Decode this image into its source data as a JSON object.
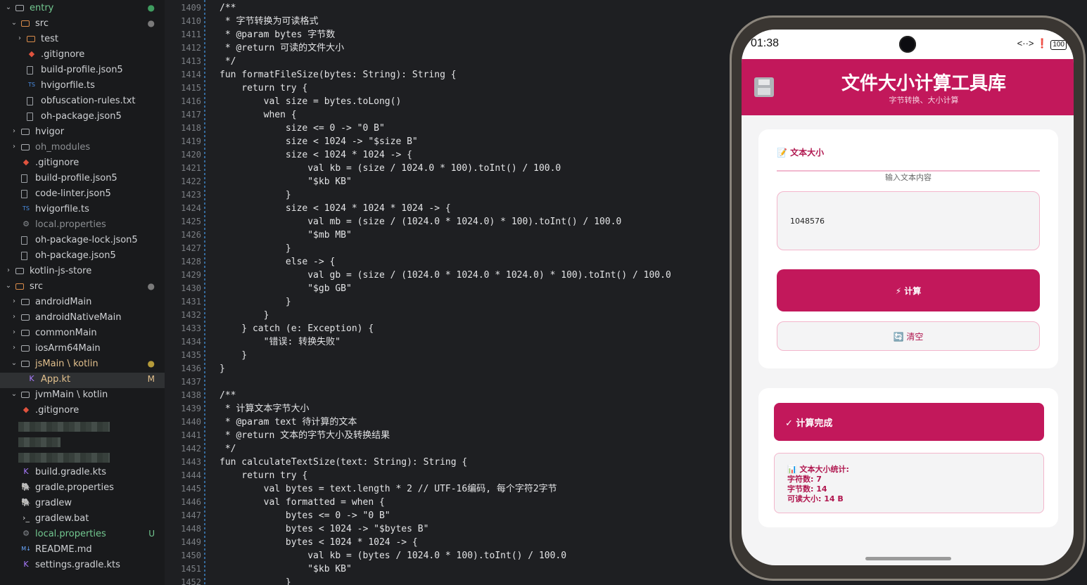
{
  "explorer": {
    "items": [
      {
        "label": "entry",
        "type": "folder",
        "expanded": true,
        "depth": 0,
        "badge": "●",
        "badge_color": "#3f9c5f",
        "label_color": "#73c991"
      },
      {
        "label": "src",
        "type": "folder-src",
        "expanded": true,
        "depth": 1,
        "badge": "●",
        "badge_color": "#7a7a7a"
      },
      {
        "label": "test",
        "type": "folder-src",
        "expanded": false,
        "depth": 2,
        "badge": ""
      },
      {
        "label": ".gitignore",
        "type": "git",
        "depth": 2,
        "badge": ""
      },
      {
        "label": "build-profile.json5",
        "type": "file",
        "depth": 2,
        "badge": ""
      },
      {
        "label": "hvigorfile.ts",
        "type": "ts",
        "depth": 2,
        "badge": ""
      },
      {
        "label": "obfuscation-rules.txt",
        "type": "file",
        "depth": 2,
        "badge": ""
      },
      {
        "label": "oh-package.json5",
        "type": "file",
        "depth": 2,
        "badge": ""
      },
      {
        "label": "hvigor",
        "type": "folder",
        "expanded": false,
        "depth": 1,
        "badge": ""
      },
      {
        "label": "oh_modules",
        "type": "folder",
        "expanded": false,
        "depth": 1,
        "badge": "",
        "label_color": "#8c8f93"
      },
      {
        "label": ".gitignore",
        "type": "git",
        "depth": 1,
        "badge": ""
      },
      {
        "label": "build-profile.json5",
        "type": "file",
        "depth": 1,
        "badge": ""
      },
      {
        "label": "code-linter.json5",
        "type": "file",
        "depth": 1,
        "badge": ""
      },
      {
        "label": "hvigorfile.ts",
        "type": "ts",
        "depth": 1,
        "badge": ""
      },
      {
        "label": "local.properties",
        "type": "gear",
        "depth": 1,
        "badge": "",
        "label_color": "#8c8f93"
      },
      {
        "label": "oh-package-lock.json5",
        "type": "file",
        "depth": 1,
        "badge": ""
      },
      {
        "label": "oh-package.json5",
        "type": "file",
        "depth": 1,
        "badge": ""
      },
      {
        "label": "kotlin-js-store",
        "type": "folder",
        "expanded": false,
        "depth": 0,
        "badge": ""
      },
      {
        "label": "src",
        "type": "folder-src",
        "expanded": true,
        "depth": 0,
        "badge": "●",
        "badge_color": "#7a7a7a"
      },
      {
        "label": "androidMain",
        "type": "folder",
        "expanded": false,
        "depth": 1,
        "badge": ""
      },
      {
        "label": "androidNativeMain",
        "type": "folder",
        "expanded": false,
        "depth": 1,
        "badge": ""
      },
      {
        "label": "commonMain",
        "type": "folder",
        "expanded": false,
        "depth": 1,
        "badge": ""
      },
      {
        "label": "iosArm64Main",
        "type": "folder",
        "expanded": false,
        "depth": 1,
        "badge": ""
      },
      {
        "label": "jsMain \\ kotlin",
        "type": "folder",
        "expanded": true,
        "depth": 1,
        "badge": "●",
        "badge_color": "#b59b3a",
        "label_color": "#e2c08d"
      },
      {
        "label": "App.kt",
        "type": "kotlin",
        "depth": 2,
        "badge": "M",
        "badge_color": "#e2c08d",
        "label_color": "#e2c08d",
        "active": true
      },
      {
        "label": "jvmMain \\ kotlin",
        "type": "folder",
        "expanded": true,
        "depth": 1,
        "badge": ""
      },
      {
        "label": ".gitignore",
        "type": "git",
        "depth": 1,
        "badge": ""
      },
      {
        "label": "",
        "type": "blur",
        "depth": 1,
        "badge": ""
      },
      {
        "label": "",
        "type": "blur",
        "depth": 1,
        "badge": ""
      },
      {
        "label": "",
        "type": "blur",
        "depth": 1,
        "badge": ""
      },
      {
        "label": "build.gradle.kts",
        "type": "kotlin",
        "depth": 1,
        "badge": ""
      },
      {
        "label": "gradle.properties",
        "type": "gradle",
        "depth": 1,
        "badge": ""
      },
      {
        "label": "gradlew",
        "type": "gradle",
        "depth": 1,
        "badge": ""
      },
      {
        "label": "gradlew.bat",
        "type": "terminal",
        "depth": 1,
        "badge": ""
      },
      {
        "label": "local.properties",
        "type": "gear",
        "depth": 1,
        "badge": "U",
        "badge_color": "#73c991",
        "label_color": "#73c991"
      },
      {
        "label": "README.md",
        "type": "md",
        "depth": 1,
        "badge": ""
      },
      {
        "label": "settings.gradle.kts",
        "type": "kotlin",
        "depth": 1,
        "badge": ""
      }
    ]
  },
  "editor": {
    "first_line": 1409,
    "lines": [
      "/**",
      " * 字节转换为可读格式",
      " * @param bytes 字节数",
      " * @return 可读的文件大小",
      " */",
      "fun formatFileSize(bytes: String): String {",
      "    return try {",
      "        val size = bytes.toLong()",
      "        when {",
      "            size <= 0 -> \"0 B\"",
      "            size < 1024 -> \"$size B\"",
      "            size < 1024 * 1024 -> {",
      "                val kb = (size / 1024.0 * 100).toInt() / 100.0",
      "                \"$kb KB\"",
      "            }",
      "            size < 1024 * 1024 * 1024 -> {",
      "                val mb = (size / (1024.0 * 1024.0) * 100).toInt() / 100.0",
      "                \"$mb MB\"",
      "            }",
      "            else -> {",
      "                val gb = (size / (1024.0 * 1024.0 * 1024.0) * 100).toInt() / 100.0",
      "                \"$gb GB\"",
      "            }",
      "        }",
      "    } catch (e: Exception) {",
      "        \"错误: 转换失败\"",
      "    }",
      "}",
      "",
      "/**",
      " * 计算文本字节大小",
      " * @param text 待计算的文本",
      " * @return 文本的字节大小及转换结果",
      " */",
      "fun calculateTextSize(text: String): String {",
      "    return try {",
      "        val bytes = text.length * 2 // UTF-16编码, 每个字符2字节",
      "        val formatted = when {",
      "            bytes <= 0 -> \"0 B\"",
      "            bytes < 1024 -> \"$bytes B\"",
      "            bytes < 1024 * 1024 -> {",
      "                val kb = (bytes / 1024.0 * 100).toInt() / 100.0",
      "                \"$kb KB\"",
      "            }"
    ]
  },
  "phone": {
    "status": {
      "time": "01:38",
      "icons": "<··> ❗",
      "battery": "100"
    },
    "header": {
      "title": "文件大小计算工具库",
      "subtitle": "字节转换、大小计算",
      "icon": "floppy-disk-icon"
    },
    "input_card": {
      "section_title": "📝 文本大小",
      "hint": "输入文本内容",
      "input_value": "1048576",
      "calc_label": "⚡ 计算",
      "clear_label": "🔄 清空"
    },
    "result_card": {
      "banner": "✓ 计算完成",
      "stats_title": "📊 文本大小统计:",
      "char_count": "字符数: 7",
      "byte_count": "字节数: 14",
      "readable": "可读大小: 14 B"
    }
  },
  "colors": {
    "accent": "#c2185b",
    "accent_light": "#f3b6cc",
    "editor_bg": "#1e1f22",
    "explorer_bg": "#191a1c"
  }
}
